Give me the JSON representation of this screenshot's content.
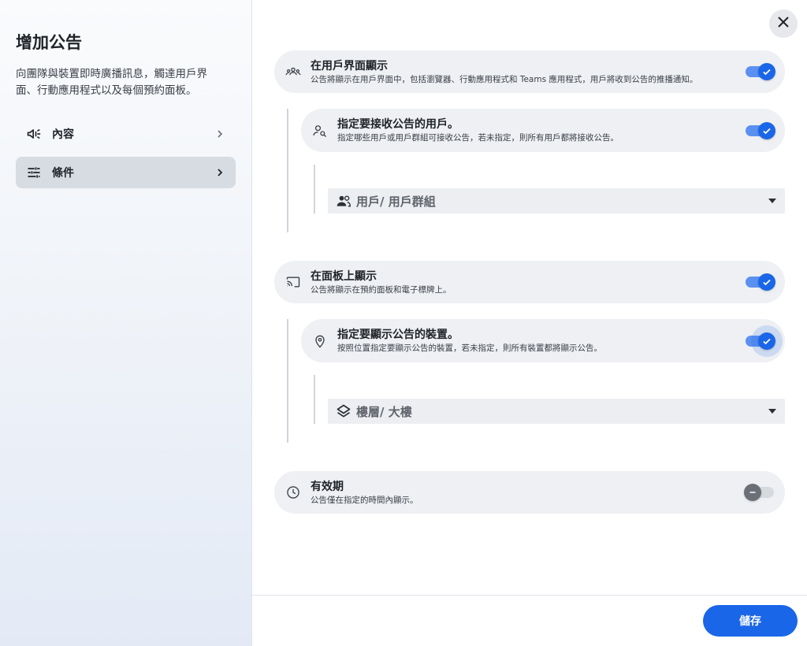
{
  "sidebar": {
    "title": "增加公告",
    "description": "向團隊與裝置即時廣播訊息，觸達用戶界面、行動應用程式以及每個預約面板。",
    "items": [
      {
        "label": "內容",
        "icon": "megaphone-icon",
        "active": false
      },
      {
        "label": "條件",
        "icon": "tune-icon",
        "active": true
      }
    ]
  },
  "sections": {
    "user_interface": {
      "title": "在用戶界面顯示",
      "subtitle": "公告將顯示在用戶界面中，包括瀏覽器、行動應用程式和 Teams 應用程式，用戶將收到公告的推播通知。",
      "enabled": true,
      "specify_users": {
        "title": "指定要接收公告的用戶。",
        "subtitle": "指定哪些用戶或用戶群組可接收公告，若未指定，則所有用戶都將接收公告。",
        "enabled": true,
        "select_placeholder": "用戶/ 用戶群組"
      }
    },
    "panel": {
      "title": "在面板上顯示",
      "subtitle": "公告將顯示在預約面板和電子標牌上。",
      "enabled": true,
      "specify_devices": {
        "title": "指定要顯示公告的裝置。",
        "subtitle": "按照位置指定要顯示公告的裝置，若未指定，則所有裝置都將顯示公告。",
        "enabled": true,
        "select_placeholder": "樓層/ 大樓"
      }
    },
    "validity": {
      "title": "有效期",
      "subtitle": "公告僅在指定的時間內顯示。",
      "enabled": false
    }
  },
  "footer": {
    "save_label": "儲存"
  },
  "colors": {
    "accent": "#1a66e8",
    "card_bg": "#eef0f3"
  }
}
